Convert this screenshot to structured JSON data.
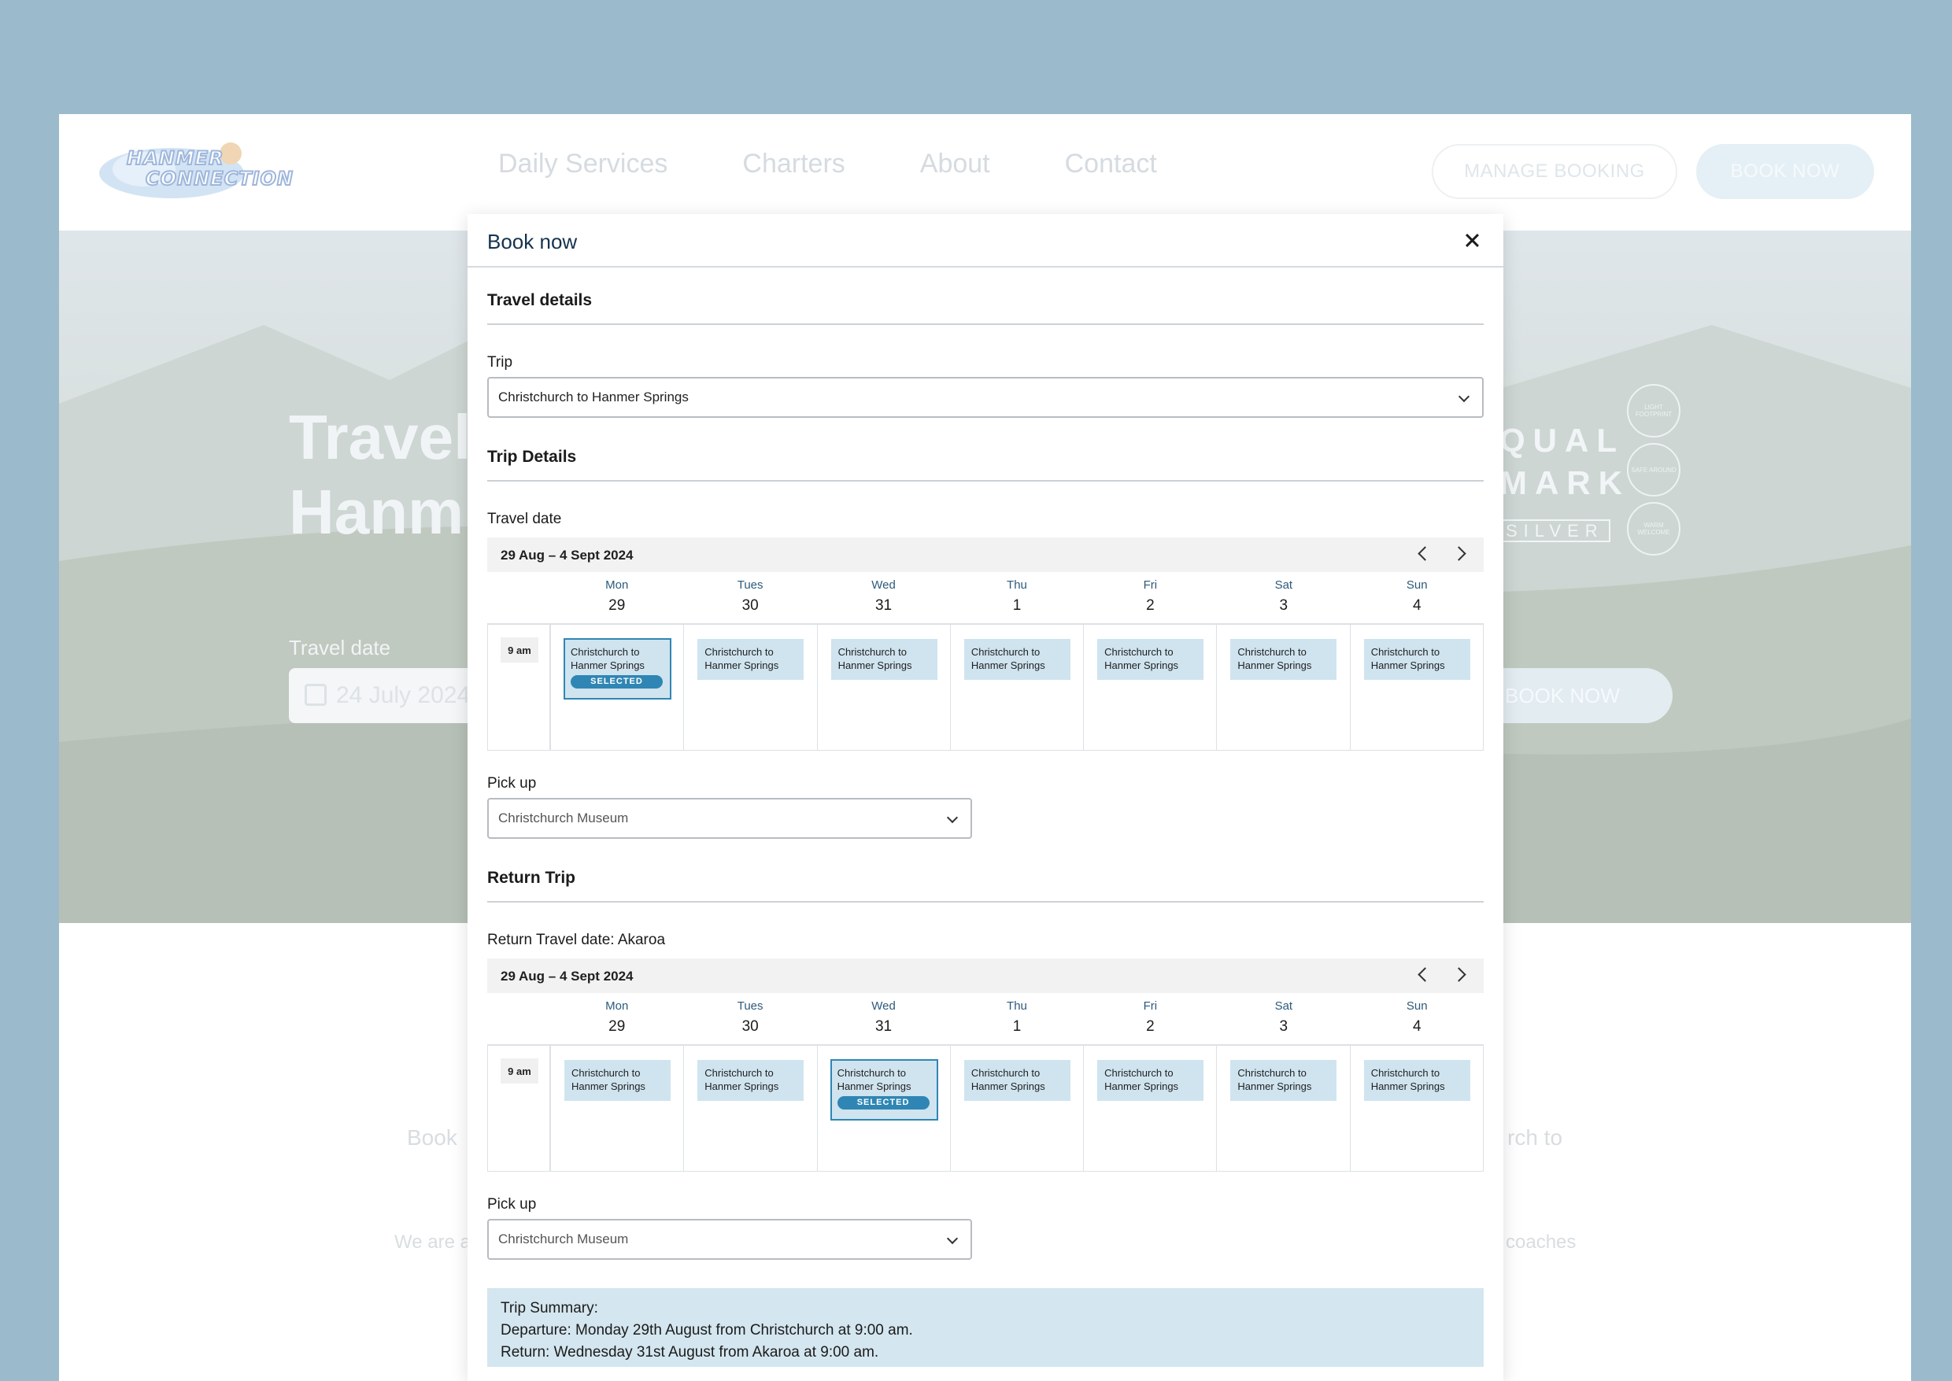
{
  "site": {
    "logo_line1": "HANMER",
    "logo_line2": "CONNECTION",
    "nav": [
      "Daily Services",
      "Charters",
      "About",
      "Contact"
    ],
    "manage_booking": "MANAGE BOOKING",
    "book_now": "BOOK NOW",
    "hero_title_line1": "Travel",
    "hero_title_line2": "Hanm",
    "hero_travel_date_label": "Travel date",
    "hero_travel_date_value": "24 July 2024",
    "hero_book_now": "BOOK NOW",
    "qualmark": {
      "line1": "QUAL",
      "line2": "MARK",
      "line3": "SILVER"
    },
    "badges": [
      "LIGHT FOOTPRINT",
      "SAFE AROUND",
      "WARM WELCOME"
    ],
    "body_left": "Book",
    "body_right": "rch to",
    "body_small_left": "We are a",
    "body_small_right": "coaches"
  },
  "modal": {
    "title": "Book now",
    "travel_details_heading": "Travel details",
    "trip_label": "Trip",
    "trip_value": "Christchurch to Hanmer Springs",
    "trip_details_heading": "Trip Details",
    "travel_date_label": "Travel date",
    "outbound": {
      "range": "29 Aug – 4 Sept 2024",
      "time": "9 am",
      "selected_label": "SELECTED",
      "days": [
        {
          "name": "Mon",
          "date": "29",
          "slot": "Christchurch to Hanmer Springs",
          "selected": true
        },
        {
          "name": "Tues",
          "date": "30",
          "slot": "Christchurch to Hanmer Springs",
          "selected": false
        },
        {
          "name": "Wed",
          "date": "31",
          "slot": "Christchurch to Hanmer Springs",
          "selected": false
        },
        {
          "name": "Thu",
          "date": "1",
          "slot": "Christchurch to Hanmer Springs",
          "selected": false
        },
        {
          "name": "Fri",
          "date": "2",
          "slot": "Christchurch to Hanmer Springs",
          "selected": false
        },
        {
          "name": "Sat",
          "date": "3",
          "slot": "Christchurch to Hanmer Springs",
          "selected": false
        },
        {
          "name": "Sun",
          "date": "4",
          "slot": "Christchurch to Hanmer Springs",
          "selected": false
        }
      ]
    },
    "pickup_label": "Pick up",
    "pickup_value": "Christchurch Museum",
    "return_heading": "Return Trip",
    "return_date_label": "Return Travel date: Akaroa",
    "return": {
      "range": "29 Aug – 4 Sept 2024",
      "time": "9 am",
      "selected_label": "SELECTED",
      "days": [
        {
          "name": "Mon",
          "date": "29",
          "slot": "Christchurch to Hanmer Springs",
          "selected": false
        },
        {
          "name": "Tues",
          "date": "30",
          "slot": "Christchurch to Hanmer Springs",
          "selected": false
        },
        {
          "name": "Wed",
          "date": "31",
          "slot": "Christchurch to Hanmer Springs",
          "selected": true
        },
        {
          "name": "Thu",
          "date": "1",
          "slot": "Christchurch to Hanmer Springs",
          "selected": false
        },
        {
          "name": "Fri",
          "date": "2",
          "slot": "Christchurch to Hanmer Springs",
          "selected": false
        },
        {
          "name": "Sat",
          "date": "3",
          "slot": "Christchurch to Hanmer Springs",
          "selected": false
        },
        {
          "name": "Sun",
          "date": "4",
          "slot": "Christchurch to Hanmer Springs",
          "selected": false
        }
      ]
    },
    "return_pickup_label": "Pick up",
    "return_pickup_value": "Christchurch Museum",
    "summary": {
      "heading": "Trip Summary:",
      "departure": "Departure: Monday 29th August from Christchurch at 9:00 am.",
      "return": "Return: Wednesday 31st August from Akaroa at 9:00 am."
    }
  },
  "colors": {
    "page_bg": "#9bbbcc",
    "slot_bg": "#cfe4ef",
    "selected_accent": "#2f86b4",
    "summary_bg": "#d4e6ef",
    "modal_title": "#15334f"
  }
}
